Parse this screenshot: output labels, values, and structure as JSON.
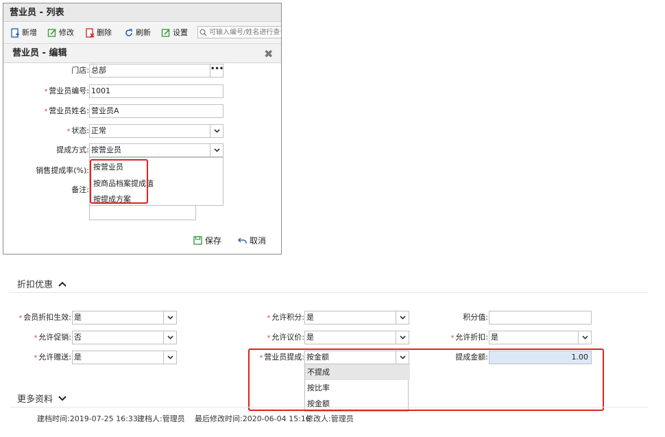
{
  "window": {
    "title": "营业员 - 列表",
    "toolbar": {
      "add": "新增",
      "edit": "修改",
      "delete": "删除",
      "refresh": "刷新",
      "settings": "设置",
      "search_placeholder": "可输入编号/姓名进行查询"
    }
  },
  "dialog": {
    "title": "营业员 - 编辑",
    "fields": {
      "store": {
        "label": "门店:",
        "value": "总部"
      },
      "code": {
        "label": "营业员编号:",
        "value": "1001"
      },
      "name": {
        "label": "营业员姓名:",
        "value": "营业员A"
      },
      "status": {
        "label": "状态:",
        "value": "正常"
      },
      "commission_method": {
        "label": "提成方式:",
        "value": "按营业员"
      },
      "sales_rate": {
        "label": "销售提成率(%):"
      },
      "remark": {
        "label": "备注:"
      }
    },
    "commission_options": [
      "按营业员",
      "按商品档案提成值",
      "按提成方案"
    ],
    "save": "保存",
    "cancel": "取消"
  },
  "discount_section": {
    "title": "折扣优惠",
    "rows": {
      "member_discount": {
        "label": "会员折扣生效:",
        "value": "是"
      },
      "allow_points": {
        "label": "允许积分:",
        "value": "是"
      },
      "points_value": {
        "label": "积分值:",
        "value": ""
      },
      "allow_promo": {
        "label": "允许促销:",
        "value": "否"
      },
      "allow_bargain": {
        "label": "允许议价:",
        "value": "是"
      },
      "allow_discount": {
        "label": "允许折扣:",
        "value": "是"
      },
      "allow_gift": {
        "label": "允许赠送:",
        "value": "是"
      },
      "clerk_commission": {
        "label": "营业员提成:",
        "value": "按金额"
      },
      "commission_amount": {
        "label": "提成金额:",
        "value": "1.00"
      }
    },
    "clerk_commission_options": [
      "不提成",
      "按比率",
      "按金额"
    ]
  },
  "more_section": {
    "title": "更多资料"
  },
  "footer": {
    "created_time_label": "建档时间:",
    "created_time": "2019-07-25 16:33",
    "creator_label": "建档人:",
    "creator": "管理员",
    "modified_time_label": "最后修改时间:",
    "modified_time": "2020-06-04 15:16",
    "modifier_label": "修改人:",
    "modifier": "管理员"
  },
  "colors": {
    "required": "#d9302a",
    "highlight_border": "#e02020",
    "amount_bg": "#dde8f7"
  }
}
